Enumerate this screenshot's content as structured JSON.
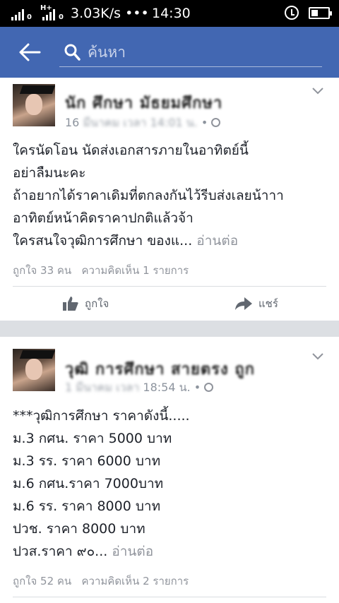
{
  "status_bar": {
    "network_label_1": "0",
    "network_label_2": "H+",
    "speed": "3.03K/s •••",
    "time": "14:30"
  },
  "topbar": {
    "search_placeholder": "ค้นหา"
  },
  "posts": [
    {
      "author": "นัก ศึกษา มัธยมศึกษา",
      "meta_prefix": "16",
      "meta_blur": "มีนาคม เวลา 14:01 น.",
      "meta_suffix": "•",
      "lines": [
        "ใครนัดโอน นัดส่งเอกสารภายในอาทิตย์นี้",
        "อย่าลืมนะคะ",
        "ถ้าอยากได้ราคาเดิมที่ตกลงกันไว้รีบส่งเลยน้าาา",
        "อาทิตย์หน้าคิดราคาปกติแล้วจ้า"
      ],
      "last_line": "ใครสนใจวุฒิการศึกษา ของแ...",
      "see_more": "อ่านต่อ",
      "likes": "ถูกใจ 33 คน",
      "comments": "ความคิดเห็น 1 รายการ",
      "like_label": "ถูกใจ",
      "share_label": "แชร์"
    },
    {
      "author": "วุฒิ การศึกษา สายตรง ถูก",
      "meta_blur": "1 มีนาคม เวลา",
      "meta_time": "18:54 น. •",
      "lines": [
        "***วุฒิการศึกษา ราคาดังนี้.....",
        "ม.3 กศน. ราคา 5000 บาท",
        "ม.3 รร. ราคา 6000 บาท",
        "ม.6 กศน.ราคา 7000บาท",
        "ม.6 รร. ราคา 8000 บาท",
        "ปวช. ราคา 8000 บาท"
      ],
      "last_line": "ปวส.ราคา ๙๐...",
      "see_more": "อ่านต่อ",
      "likes": "ถูกใจ 52 คน",
      "comments": "ความคิดเห็น 2 รายการ"
    }
  ],
  "colors": {
    "header": "#4267b2",
    "feed_background": "#e9ebee",
    "secondary_text": "#90949c"
  },
  "icons": [
    "back-arrow-icon",
    "search-icon",
    "alarm-icon",
    "battery-icon",
    "chevron-down-icon",
    "globe-icon",
    "like-icon",
    "share-icon"
  ]
}
